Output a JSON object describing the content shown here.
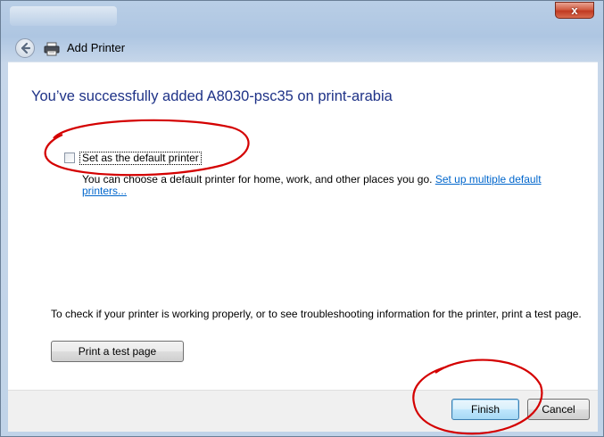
{
  "window": {
    "title": "Add Printer",
    "close_glyph": "x"
  },
  "main": {
    "heading": "You’ve successfully added A8030-psc35 on print-arabia",
    "default_checkbox": {
      "label": "Set as the default printer",
      "checked": false
    },
    "description": "You can choose a default printer for home, work, and other places you go.",
    "description_link": "Set up multiple default printers...",
    "check_text": "To check if your printer is working properly, or to see troubleshooting information for the printer, print a test page.",
    "test_button": "Print a test page"
  },
  "footer": {
    "finish_button": "Finish",
    "cancel_button": "Cancel"
  },
  "icons": {
    "back": "back-arrow-icon",
    "printer": "printer-icon",
    "close": "close-icon"
  },
  "colors": {
    "heading": "#1e3287",
    "link": "#0066cc",
    "annotation": "#d40000",
    "close_button": "#c13a22"
  }
}
